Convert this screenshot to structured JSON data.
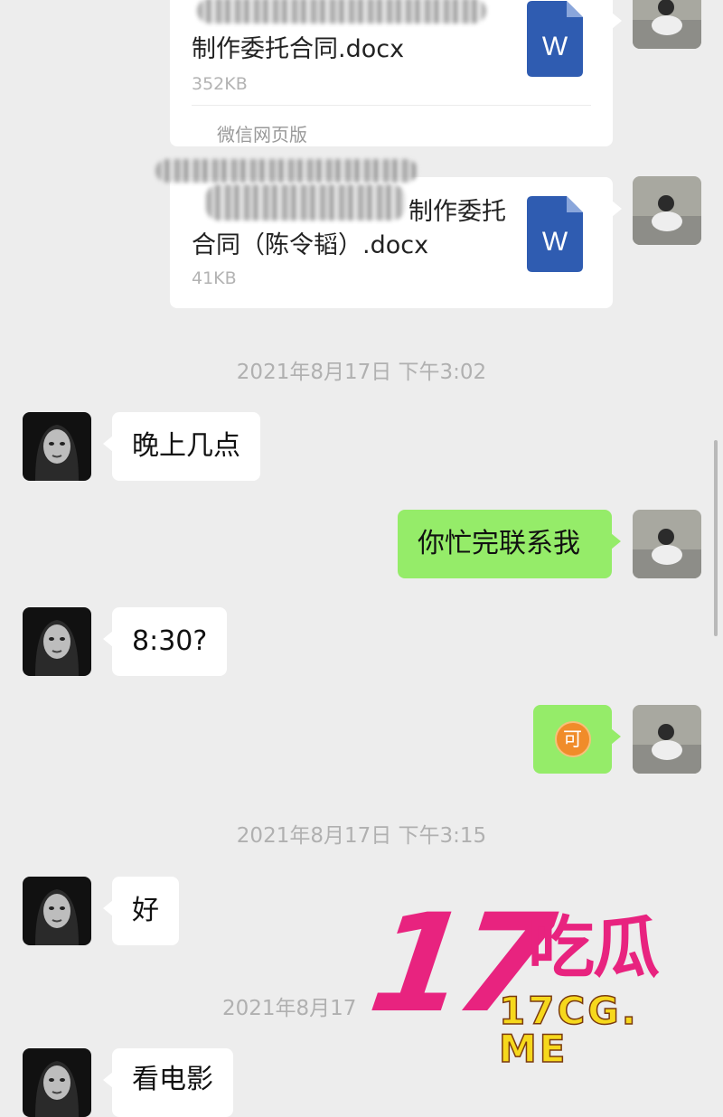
{
  "conversation": {
    "file_messages": [
      {
        "file_name_visible": "制作委托合同.docx",
        "file_size": "352KB",
        "source": "微信网页版",
        "file_icon": "word-doc-icon"
      },
      {
        "file_name_line1_visible": "制作委托",
        "file_name_line2": "合同（陈令韬）.docx",
        "file_size": "41KB",
        "file_icon": "word-doc-icon"
      }
    ],
    "timestamps": [
      "2021年8月17日 下午3:02",
      "2021年8月17日 下午3:15",
      "2021年8月17"
    ],
    "messages": [
      {
        "side": "in",
        "text": "晚上几点"
      },
      {
        "side": "out",
        "text": "你忙完联系我"
      },
      {
        "side": "in",
        "text": "8:30?"
      },
      {
        "side": "out",
        "sticker": "可"
      },
      {
        "side": "in",
        "text": "好"
      },
      {
        "side": "in",
        "text": "看电影"
      }
    ]
  },
  "watermark": {
    "big": "17",
    "brand_cn": "吃瓜",
    "domain": "17CG. ME"
  },
  "colors": {
    "background": "#ededed",
    "outgoing_bubble": "#95ec69",
    "incoming_bubble": "#ffffff",
    "timestamp": "#b0b0b0",
    "word_icon": "#2f5cb1",
    "watermark_pink": "#e8237f",
    "watermark_yellow": "#f6d81c"
  }
}
